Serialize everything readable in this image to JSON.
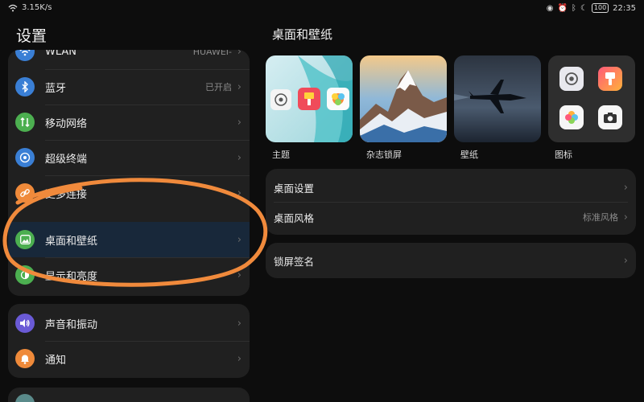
{
  "status_bar": {
    "speed": "3.15K/s",
    "battery": "100",
    "time": "22:35"
  },
  "left": {
    "title": "设置",
    "card1": [
      {
        "label": "WLAN",
        "value": "HUAWEI-",
        "icon": "wifi-icon"
      },
      {
        "label": "蓝牙",
        "value": "已开启",
        "icon": "bluetooth-icon"
      },
      {
        "label": "移动网络",
        "value": "",
        "icon": "mobile-network-icon"
      },
      {
        "label": "超级终端",
        "value": "",
        "icon": "super-device-icon"
      },
      {
        "label": "更多连接",
        "value": "",
        "icon": "link-icon"
      },
      {
        "label": "桌面和壁纸",
        "value": "",
        "icon": "wallpaper-icon"
      },
      {
        "label": "显示和亮度",
        "value": "",
        "icon": "display-icon"
      }
    ],
    "card2": [
      {
        "label": "声音和振动",
        "value": "",
        "icon": "sound-icon"
      },
      {
        "label": "通知",
        "value": "",
        "icon": "bell-icon"
      }
    ]
  },
  "right": {
    "title": "桌面和壁纸",
    "thumbnails": [
      {
        "label": "主题"
      },
      {
        "label": "杂志锁屏"
      },
      {
        "label": "壁纸"
      },
      {
        "label": "图标"
      }
    ],
    "panel1": [
      {
        "label": "桌面设置",
        "value": ""
      },
      {
        "label": "桌面风格",
        "value": "标准风格"
      }
    ],
    "panel2": [
      {
        "label": "锁屏签名",
        "value": ""
      }
    ]
  },
  "colors": {
    "background": "#0d0d0d",
    "card": "#202020",
    "selected_row": "#18283a",
    "annotation": "#f08a3c"
  }
}
